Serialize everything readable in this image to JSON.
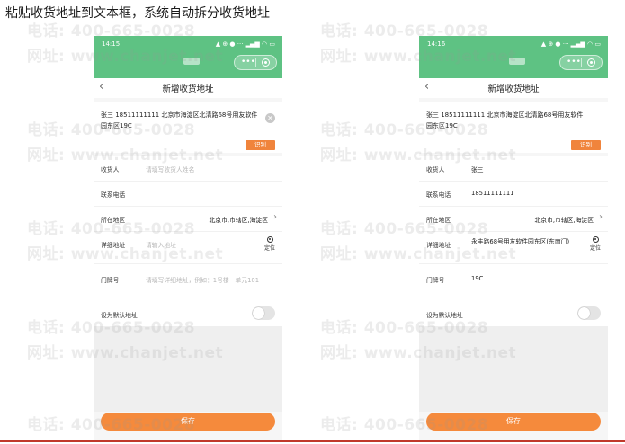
{
  "heading": "粘贴收货地址到文本框，系统自动拆分收货地址",
  "watermark": {
    "phone": "电话: 400-665-0028",
    "website": "网址: www.chanjet.net"
  },
  "screens": {
    "before": {
      "status_time": "14:15",
      "status_icons": "▲ ⊕ ● ···     ▂▄▆ ◠ ▭",
      "nav_back": "‹",
      "nav_title": "新增收货地址",
      "paste_text": "张三 18511111111 北京市海淀区北清路68号用友软件园东区19C",
      "recognize_label": "识别",
      "fields": {
        "name_label": "收货人",
        "name_value": "请填写收货人姓名",
        "phone_label": "联系电话",
        "phone_value": "",
        "region_label": "所在地区",
        "region_value": "北京市,市辖区,海淀区",
        "detail_label": "详细地址",
        "detail_value": "请输入地址",
        "locate_label": "定位",
        "door_label": "门牌号",
        "door_value": "请填写详细地址，例如：1号楼一单元101"
      },
      "default_label": "设为默认地址",
      "save_label": "保存"
    },
    "after": {
      "status_time": "14:16",
      "status_icons": "▲ ⊕ ● ···     ▂▄▆ ◠ ▭",
      "nav_back": "‹",
      "nav_title": "新增收货地址",
      "paste_text": "张三 18511111111 北京市海淀区北清路68号用友软件园东区19C",
      "recognize_label": "识别",
      "fields": {
        "name_label": "收货人",
        "name_value": "张三",
        "phone_label": "联系电话",
        "phone_value": "18511111111",
        "region_label": "所在地区",
        "region_value": "北京市,市辖区,海淀区",
        "detail_label": "详细地址",
        "detail_value": "永丰路68号用友软件园东区(东南门)",
        "locate_label": "定位",
        "door_label": "门牌号",
        "door_value": "19C"
      },
      "default_label": "设为默认地址",
      "save_label": "保存"
    }
  },
  "colors": {
    "status_bar": "#5ec283",
    "accent": "#f0843c"
  }
}
